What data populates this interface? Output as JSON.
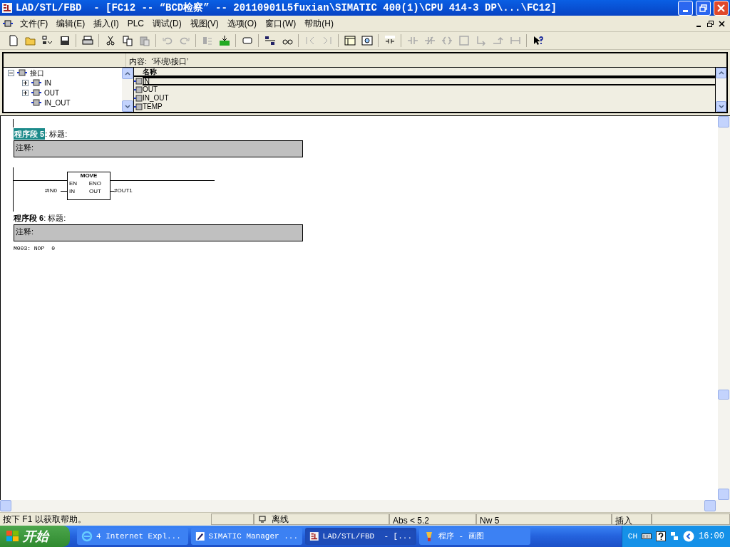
{
  "window": {
    "title": "LAD/STL/FBD  - [FC12 -- “BCD检察” -- 20110901L5fuxian\\SIMATIC 400(1)\\CPU 414-3 DP\\...\\FC12]"
  },
  "menu": [
    "文件(F)",
    "编辑(E)",
    "插入(I)",
    "PLC",
    "调试(D)",
    "视图(V)",
    "选项(O)",
    "窗口(W)",
    "帮助(H)"
  ],
  "interface": {
    "content_label": "内容:  ‘环境\\接口’",
    "tree": [
      {
        "label": "接口",
        "expanded": true,
        "children": [
          {
            "label": "IN",
            "expanded": false
          },
          {
            "label": "OUT",
            "expanded": false
          },
          {
            "label": "IN_OUT"
          }
        ]
      }
    ],
    "table": {
      "column": "名称",
      "rows": [
        {
          "name": "IN",
          "selected": true
        },
        {
          "name": "OUT",
          "selected": false
        },
        {
          "name": "IN_OUT",
          "selected": false
        },
        {
          "name": "TEMP",
          "selected": false
        }
      ]
    }
  },
  "networks": [
    {
      "number_label": "程序段 5",
      "title_label": ": 标题:",
      "selected": true,
      "comment": "注释:",
      "kind": "ladder",
      "block": {
        "name": "MOVE",
        "pins": [
          [
            "EN",
            "ENO"
          ],
          [
            "IN",
            "OUT"
          ]
        ],
        "input": "#IN0",
        "output": "#OUT1"
      }
    },
    {
      "number_label": "程序段 6",
      "title_label": ": 标题:",
      "selected": false,
      "comment": "注释:",
      "kind": "stl",
      "lines": [
        {
          "statement": "M003: NOP",
          "operand": "0"
        }
      ]
    }
  ],
  "status_bar": {
    "help": "按下 F1 以获取帮助。",
    "mode": "离线",
    "address": "Abs < 5.2",
    "network": "Nw 5",
    "edit_mode": "插入"
  },
  "taskbar": {
    "start": "开始",
    "tasks": [
      {
        "label": "4 Internet Expl...",
        "kind": "browser",
        "selected": false
      },
      {
        "label": "SIMATIC Manager ...",
        "kind": "simatic",
        "selected": false
      },
      {
        "label": "LAD/STL/FBD  - [...",
        "kind": "editor",
        "selected": true
      },
      {
        "label": "程序 - 画图",
        "kind": "paint",
        "selected": false
      }
    ],
    "language": "CH",
    "clock": "16:00"
  }
}
